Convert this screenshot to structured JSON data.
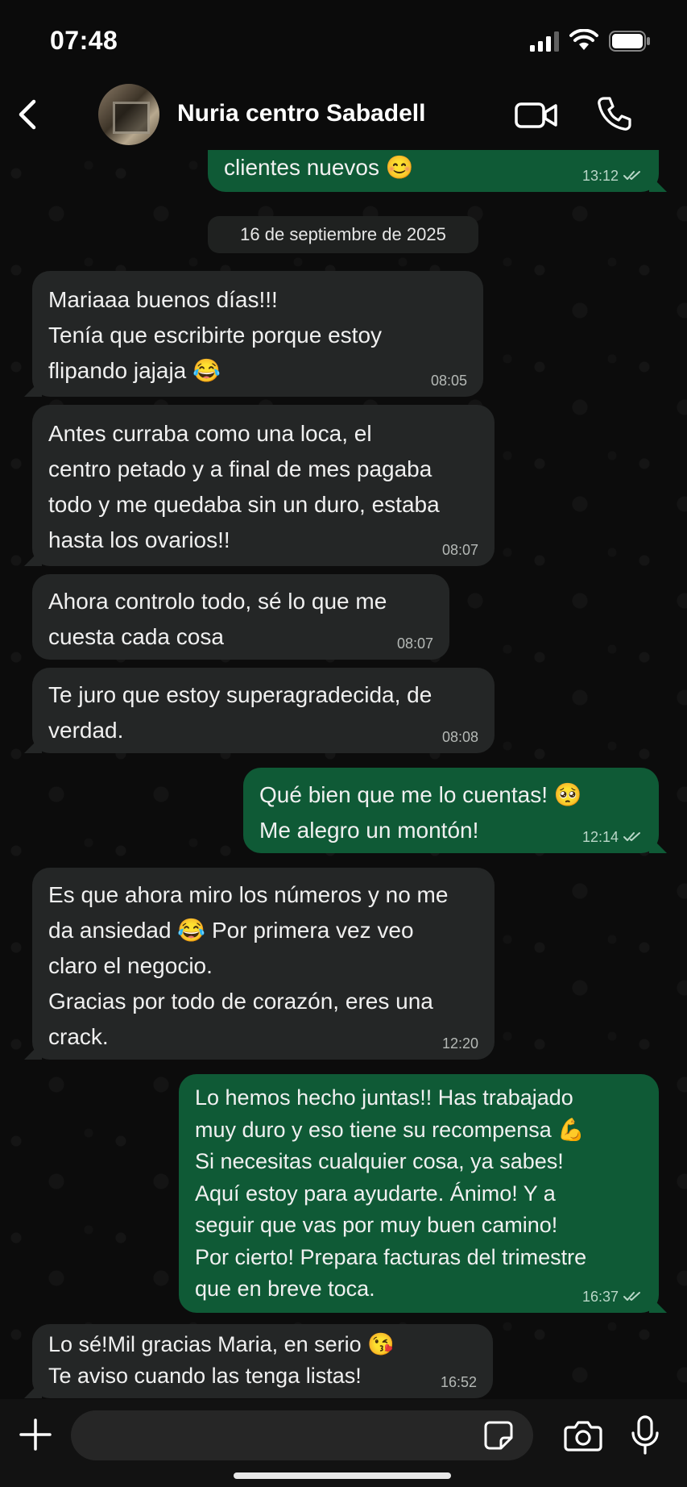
{
  "status_bar": {
    "time": "07:48"
  },
  "header": {
    "contact_name": "Nuria centro Sabadell"
  },
  "date_separator": "16 de septiembre de 2025",
  "messages": [
    {
      "text": "clientes nuevos 😊",
      "time": "13:12"
    },
    {
      "text": "Mariaaa buenos días!!!\nTenía que escribirte porque estoy\nflipando jajaja 😂",
      "time": "08:05"
    },
    {
      "text": "Antes curraba como una loca, el\ncentro petado y a final de mes pagaba\ntodo y me quedaba sin un duro, estaba\nhasta los ovarios!!",
      "time": "08:07"
    },
    {
      "text": "Ahora controlo todo, sé lo que me\ncuesta cada cosa",
      "time": "08:07"
    },
    {
      "text": "Te juro que estoy superagradecida, de\nverdad.",
      "time": "08:08"
    },
    {
      "text": "Qué bien que me lo cuentas! 🥺\nMe alegro un montón!",
      "time": "12:14"
    },
    {
      "text": "Es que ahora miro los números y no me\nda ansiedad 😂 Por primera vez veo\nclaro el negocio.\nGracias por todo de corazón, eres una\ncrack.",
      "time": "12:20"
    },
    {
      "text": "Lo hemos hecho juntas!! Has trabajado\nmuy duro y eso tiene su recompensa 💪\nSi necesitas cualquier cosa, ya sabes!\nAquí estoy para ayudarte. Ánimo! Y a\nseguir que vas por muy buen camino!\nPor cierto! Prepara facturas del trimestre\nque en breve toca.",
      "time": "16:37"
    },
    {
      "text": "Lo sé!Mil gracias Maria, en serio 😘\nTe aviso cuando las tenga listas!",
      "time": "16:52"
    }
  ],
  "composer": {
    "value": ""
  },
  "colors": {
    "incoming_bubble": "#242626",
    "outgoing_bubble": "#0f5a36",
    "background": "#0b0b0b"
  },
  "icons": [
    "back-icon",
    "video-call-icon",
    "phone-icon",
    "plus-icon",
    "sticker-icon",
    "camera-icon",
    "mic-icon",
    "read-ticks-icon"
  ]
}
